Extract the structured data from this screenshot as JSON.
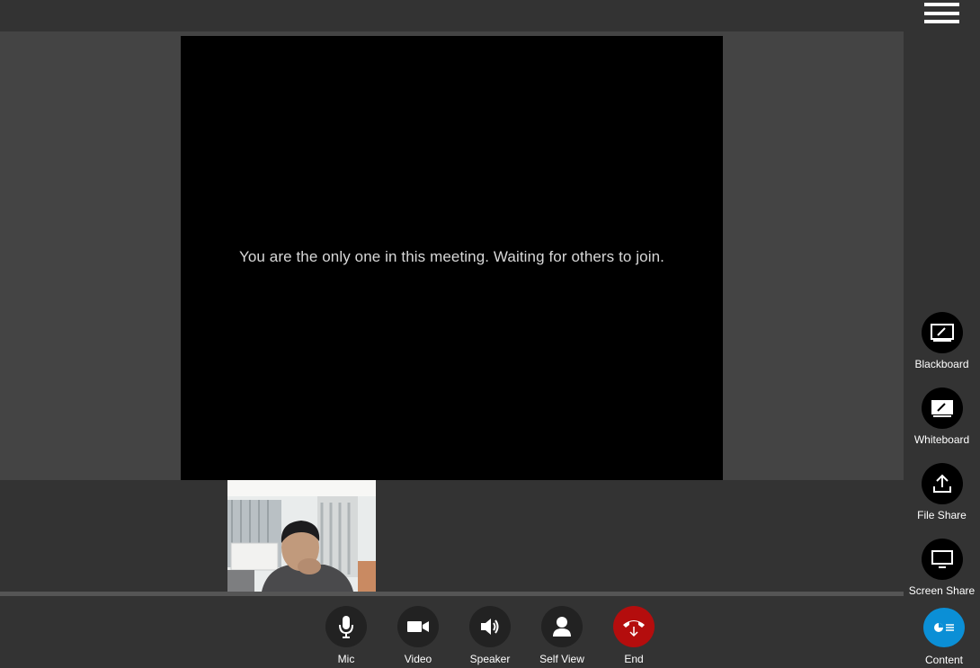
{
  "colors": {
    "accent_blue": "#0b8fd6",
    "end_red": "#b40d0d",
    "panel_dark": "#333333",
    "stage_gray": "#444444"
  },
  "main_video": {
    "status_message": "You are the only one in this meeting. Waiting for others to join."
  },
  "side_tools": [
    {
      "label": "Blackboard",
      "icon": "blackboard-icon"
    },
    {
      "label": "Whiteboard",
      "icon": "whiteboard-icon"
    },
    {
      "label": "File Share",
      "icon": "upload-icon"
    },
    {
      "label": "Screen Share",
      "icon": "monitor-icon"
    }
  ],
  "controls": [
    {
      "label": "Mic",
      "icon": "microphone-icon"
    },
    {
      "label": "Video",
      "icon": "video-camera-icon"
    },
    {
      "label": "Speaker",
      "icon": "speaker-icon"
    },
    {
      "label": "Self View",
      "icon": "person-icon"
    },
    {
      "label": "End",
      "icon": "hang-up-icon"
    }
  ],
  "content_button": {
    "label": "Content",
    "icon": "content-icon"
  }
}
